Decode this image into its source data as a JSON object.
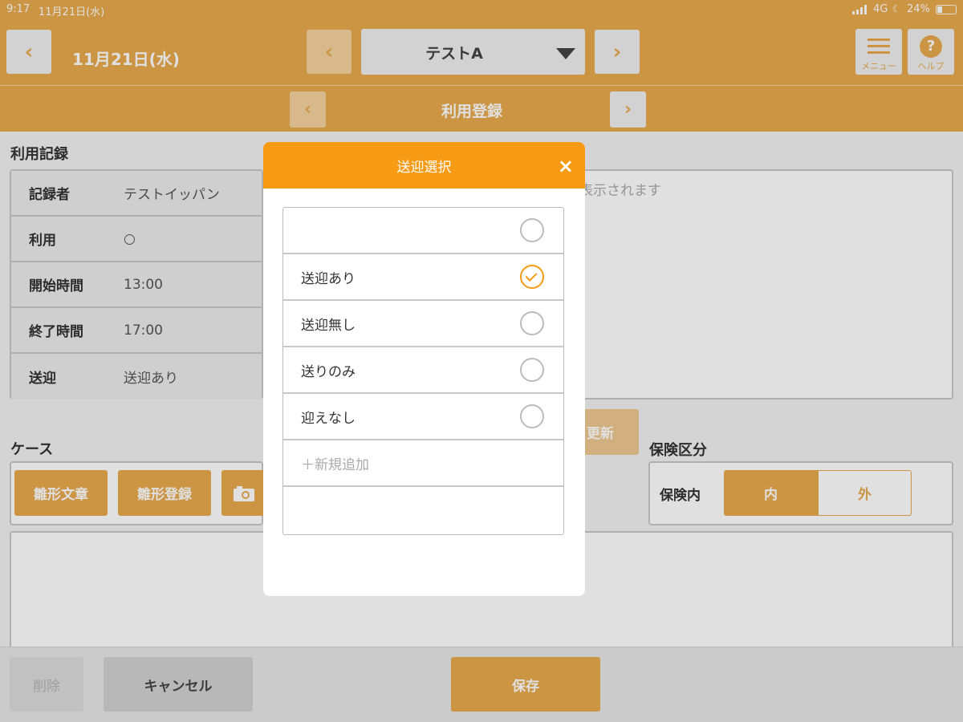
{
  "status": {
    "time": "9:17",
    "date": "11月21日(水)",
    "network": "4G",
    "battery": "24%"
  },
  "header": {
    "date": "11月21日(水)",
    "user": "テストA",
    "menu_label": "メニュー",
    "help_label": "ヘルプ",
    "help_symbol": "?",
    "prev": "‹",
    "next": "›",
    "prev_user": "‹",
    "next_user": "›"
  },
  "subheader": {
    "title": "利用登録",
    "prev": "‹",
    "next": "›"
  },
  "record": {
    "title": "利用記録",
    "rows": [
      {
        "label": "記録者",
        "value": "テストイッパン"
      },
      {
        "label": "利用",
        "value": "○"
      },
      {
        "label": "開始時間",
        "value": "13:00"
      },
      {
        "label": "終了時間",
        "value": "17:00"
      },
      {
        "label": "送迎",
        "value": "送迎あり"
      }
    ]
  },
  "notes_placeholder_fragment": "表示されます",
  "update_button_fragment": "更新",
  "case": {
    "title": "ケース",
    "template_text": "雛形文章",
    "template_register": "雛形登録"
  },
  "insurance": {
    "title": "保険区分",
    "label": "保険内",
    "in": "内",
    "out": "外"
  },
  "footer": {
    "delete": "削除",
    "cancel": "キャンセル",
    "save": "保存"
  },
  "modal": {
    "title": "送迎選択",
    "close": "×",
    "options": [
      {
        "label": "",
        "selected": false
      },
      {
        "label": "送迎あり",
        "selected": true
      },
      {
        "label": "送迎無し",
        "selected": false
      },
      {
        "label": "送りのみ",
        "selected": false
      },
      {
        "label": "迎えなし",
        "selected": false
      }
    ],
    "add_new": "＋新規追加"
  },
  "colors": {
    "accent": "#e7aa4e",
    "modal_header": "#f79b14"
  }
}
